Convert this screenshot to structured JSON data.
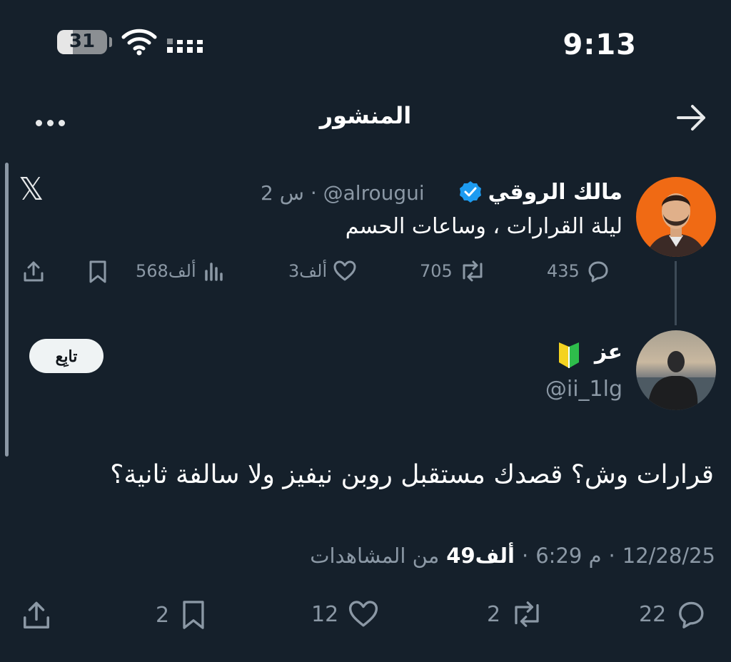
{
  "status_bar": {
    "time": "9:13",
    "battery": "31",
    "battery_level": 0.31
  },
  "header": {
    "title": "المنشور"
  },
  "quoted_post": {
    "name": "مالك الروقي",
    "handle": "@alrougui",
    "time_ago": "2 س",
    "text": "ليلة القرارات ، وساعات الحسم",
    "replies": "435",
    "reposts": "705",
    "likes": "3ألف",
    "views": "568ألف"
  },
  "main_post": {
    "name": "عز",
    "handle": "@ii_1lg",
    "follow_label": "تابِع",
    "text": "قرارات وش؟ قصدك مستقبل روبن نيفيز ولا سالفة ثانية؟",
    "date": "12/28/25",
    "time": "6:29 م",
    "views_count": "49ألف",
    "views_label": "من المشاهدات",
    "replies": "22",
    "reposts": "2",
    "likes": "12",
    "bookmarks": "2"
  },
  "colors": {
    "background": "#15202b",
    "muted": "#8b98a5",
    "verified": "#1d9bf0",
    "avatar_orange": "#f06a14"
  },
  "icons": [
    "back-arrow-icon",
    "more-icon",
    "x-logo-icon",
    "verified-icon",
    "beginner-badge-icon",
    "reply-icon",
    "repost-icon",
    "like-icon",
    "views-icon",
    "bookmark-icon",
    "share-icon",
    "wifi-icon",
    "signal-icon"
  ]
}
